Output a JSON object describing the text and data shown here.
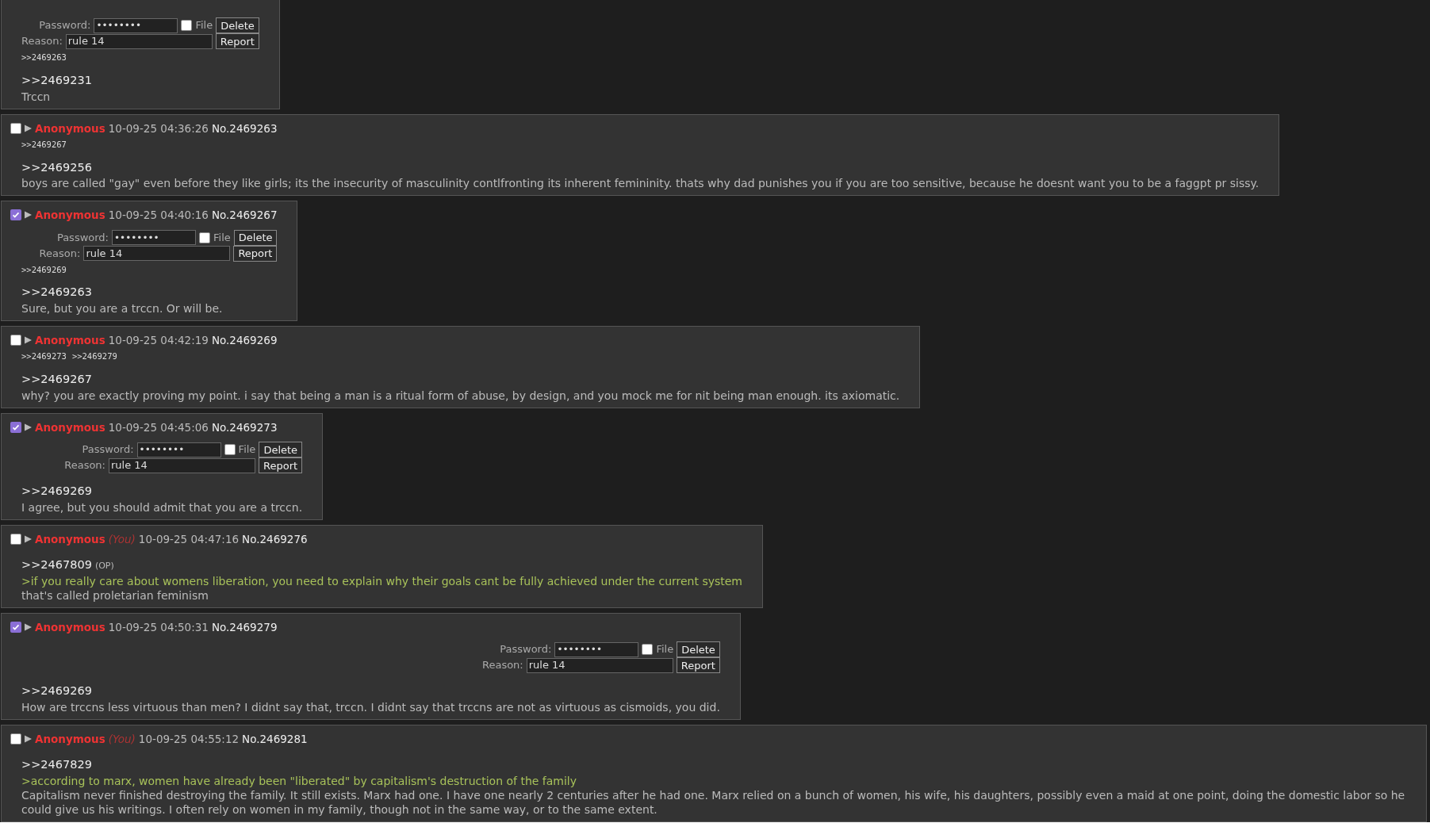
{
  "posts": [
    {
      "form": {
        "password_label": "Password:",
        "password": "••••••••",
        "file_label": "File",
        "file_checked": false,
        "reason_label": "Reason:",
        "reason": "rule 14",
        "delete": "Delete",
        "report": "Report"
      },
      "backlinks": [
        ">>2469263"
      ],
      "reply_to": ">>2469231",
      "lines": [
        {
          "kind": "text",
          "text": "Trccn"
        }
      ]
    },
    {
      "checked": false,
      "name": "Anonymous",
      "date": "10-09-25 04:36:26",
      "number": "No.2469263",
      "backlinks": [
        ">>2469267"
      ],
      "reply_to": ">>2469256",
      "lines": [
        {
          "kind": "text",
          "text": "boys are called \"gay\" even before they like girls; its the insecurity of masculinity contlfronting its inherent femininity. thats why dad punishes you if you are too sensitive, because he doesnt want you to be a faggpt pr sissy."
        }
      ]
    },
    {
      "checked": true,
      "name": "Anonymous",
      "date": "10-09-25 04:40:16",
      "number": "No.2469267",
      "form": {
        "password_label": "Password:",
        "password": "••••••••",
        "file_label": "File",
        "file_checked": false,
        "reason_label": "Reason:",
        "reason": "rule 14",
        "delete": "Delete",
        "report": "Report"
      },
      "backlinks": [
        ">>2469269"
      ],
      "reply_to": ">>2469263",
      "lines": [
        {
          "kind": "text",
          "text": "Sure, but you are a trccn. Or will be."
        }
      ]
    },
    {
      "checked": false,
      "name": "Anonymous",
      "date": "10-09-25 04:42:19",
      "number": "No.2469269",
      "backlinks": [
        ">>2469273",
        ">>2469279"
      ],
      "reply_to": ">>2469267",
      "lines": [
        {
          "kind": "text",
          "text": "why? you are exactly proving my point. i say that being a man is a ritual form of abuse, by design, and you mock me for nit being man enough. its axiomatic."
        }
      ]
    },
    {
      "checked": true,
      "name": "Anonymous",
      "date": "10-09-25 04:45:06",
      "number": "No.2469273",
      "form": {
        "password_label": "Password:",
        "password": "••••••••",
        "file_label": "File",
        "file_checked": false,
        "reason_label": "Reason:",
        "reason": "rule 14",
        "delete": "Delete",
        "report": "Report"
      },
      "reply_to": ">>2469269",
      "lines": [
        {
          "kind": "text",
          "text": "I agree, but you should admit that you are a trccn."
        }
      ]
    },
    {
      "checked": false,
      "name": "Anonymous",
      "you": "(You)",
      "date": "10-09-25 04:47:16",
      "number": "No.2469276",
      "reply_to": ">>2467809",
      "op": "(OP)",
      "lines": [
        {
          "kind": "quote",
          "text": ">if you really care about womens liberation, you need to explain why their goals cant be fully achieved under the current system"
        },
        {
          "kind": "text",
          "text": "that's called proletarian feminism"
        }
      ]
    },
    {
      "checked": true,
      "name": "Anonymous",
      "date": "10-09-25 04:50:31",
      "number": "No.2469279",
      "form": {
        "password_label": "Password:",
        "password": "••••••••",
        "file_label": "File",
        "file_checked": false,
        "reason_label": "Reason:",
        "reason": "rule 14",
        "delete": "Delete",
        "report": "Report"
      },
      "reply_to": ">>2469269",
      "lines": [
        {
          "kind": "text",
          "text": "How are trccns less virtuous than men? I didnt say that, trccn. I didnt say that trccns are not as virtuous as cismoids, you did."
        }
      ]
    },
    {
      "checked": false,
      "name": "Anonymous",
      "you": "(You)",
      "date": "10-09-25 04:55:12",
      "number": "No.2469281",
      "reply_to": ">>2467829",
      "lines": [
        {
          "kind": "quote",
          "text": ">according to marx, women have already been \"liberated\" by capitalism's destruction of the family"
        },
        {
          "kind": "text",
          "text": "Capitalism never finished destroying the family. It still exists. Marx had one. I have one nearly 2 centuries after he had one. Marx relied on a bunch of women, his wife, his daughters, possibly even a maid at one point, doing the domestic labor so he could give us his writings. I often rely on women in my family, though not in the same way, or to the same extent."
        }
      ]
    }
  ]
}
